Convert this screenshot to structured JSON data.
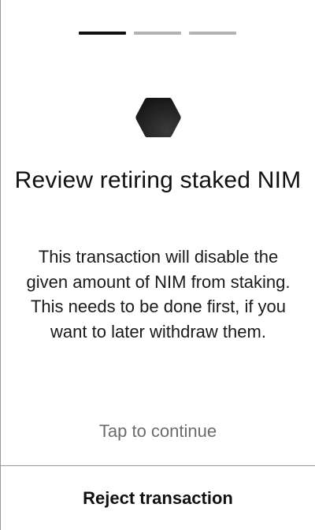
{
  "progress": {
    "total_steps": 3,
    "current_step": 1
  },
  "icon": {
    "name": "nimiq-hexagon-icon",
    "color": "#1f1f1f"
  },
  "title": "Review retiring staked NIM",
  "description": "This transaction will disable the given amount of NIM from staking. This needs to be done first, if you want to later withdraw them.",
  "tap_hint": "Tap to continue",
  "reject_label": "Reject transaction"
}
